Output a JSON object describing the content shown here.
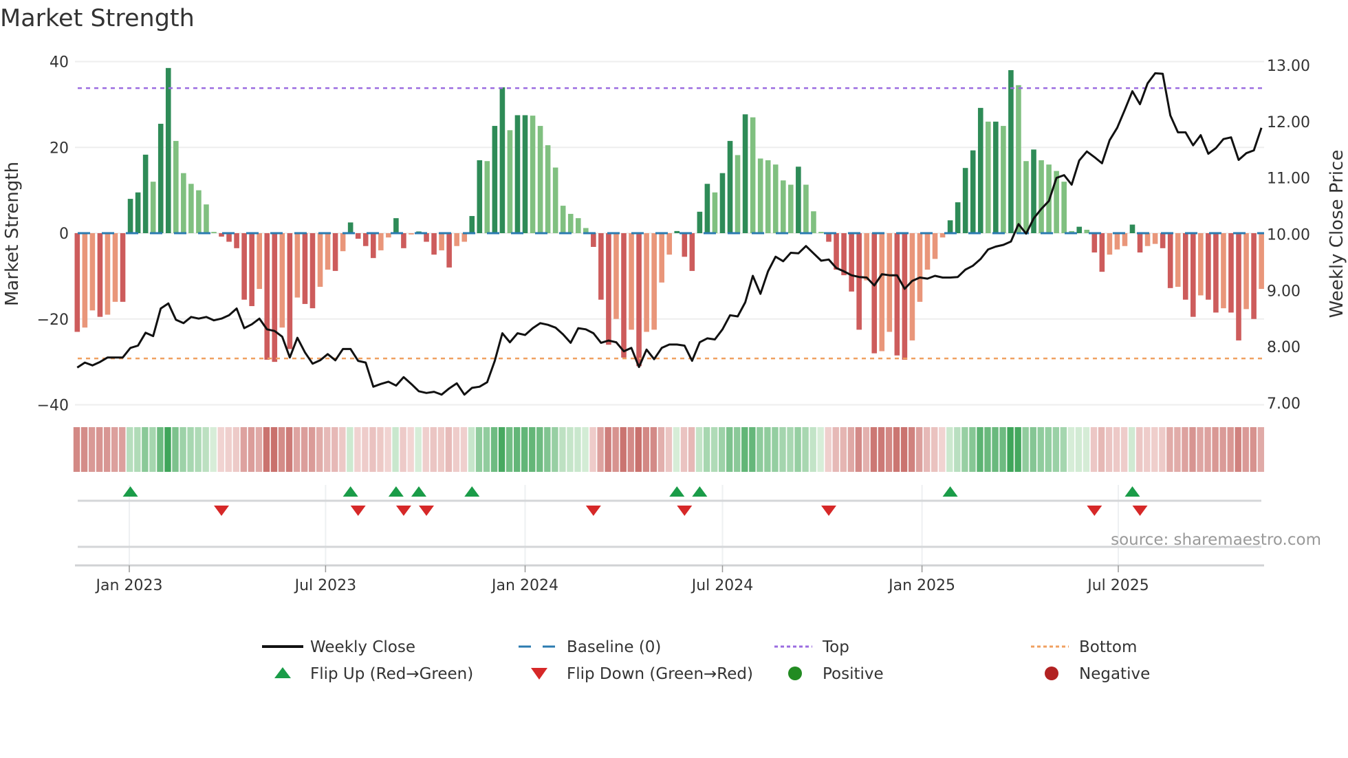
{
  "title": "Market Strength",
  "source": "source: sharemaestro.com",
  "colors": {
    "close": "#111111",
    "baseline": "#2b7bb0",
    "top": "#9b6ce0",
    "bottom": "#f0a060",
    "pos_strong": "#2e8b57",
    "pos_weak": "#80c080",
    "neg_strong": "#cd5c5c",
    "neg_weak": "#e9967a",
    "flip_up": "#1a9c48",
    "flip_down": "#d62828",
    "positive": "#228b22",
    "negative": "#b22222"
  },
  "chart_data": {
    "type": "bar+line",
    "title": "Market Strength",
    "ylabel": "Market Strength",
    "y2label": "Weekly Close Price",
    "ylim": [
      -40,
      40
    ],
    "y2lim": [
      7.0,
      13.0
    ],
    "yticks": [
      "40",
      "20",
      "0",
      "−20",
      "−40"
    ],
    "yticks_values": [
      40,
      20,
      0,
      -20,
      -40
    ],
    "y2ticks": [
      "13.00",
      "12.00",
      "11.00",
      "10.00",
      "9.00",
      "8.00",
      "7.00"
    ],
    "y2ticks_values": [
      13,
      12,
      11,
      10,
      9,
      8,
      7
    ],
    "xticks": [
      {
        "label": "Jan 2023",
        "date": "2023-01-01"
      },
      {
        "label": "Jul 2023",
        "date": "2023-07-01"
      },
      {
        "label": "Jan 2024",
        "date": "2024-01-01"
      },
      {
        "label": "Jul 2024",
        "date": "2024-07-01"
      },
      {
        "label": "Jan 2025",
        "date": "2025-01-01"
      },
      {
        "label": "Jul 2025",
        "date": "2025-07-01"
      }
    ],
    "start_week": "2022-11-14",
    "top_level": 33.8,
    "bottom_level": -29.2,
    "baseline": 0,
    "strength": [
      -23,
      -22,
      -18,
      -19.5,
      -19,
      -16,
      -16,
      8,
      9.5,
      18.3,
      12,
      25.5,
      38.5,
      21.5,
      14,
      11.5,
      10,
      6.7,
      0.3,
      -0.8,
      -2,
      -3.5,
      -15.5,
      -17,
      -13,
      -29.5,
      -30,
      -22,
      -27,
      -15,
      -16.5,
      -17.5,
      -12.5,
      -8.5,
      -8.8,
      -4.2,
      2.5,
      -1.3,
      -3,
      -5.8,
      -4,
      -1,
      3.5,
      -3.5,
      -0.3,
      0.4,
      -2,
      -5,
      -4,
      -8,
      -3,
      -2,
      4,
      17,
      16.8,
      25,
      34,
      24,
      27.5,
      27.5,
      27.4,
      25,
      20.5,
      15.3,
      6.4,
      4.5,
      3.5,
      1.2,
      -3.2,
      -15.5,
      -26,
      -20,
      -29,
      -22.5,
      -31,
      -23,
      -22.5,
      -11.5,
      -5,
      0.5,
      -5.5,
      -8.8,
      5,
      11.5,
      9.5,
      14,
      21.5,
      18.2,
      27.7,
      27,
      17.4,
      17,
      16,
      12.3,
      11.3,
      15.5,
      11.3,
      5.1,
      0.3,
      -2,
      -8.5,
      -9.8,
      -13.6,
      -22.5,
      -11,
      -28,
      -27.5,
      -23,
      -28.5,
      -29.5,
      -25,
      -16,
      -8.5,
      -6,
      -1,
      3,
      7.2,
      15.2,
      19.3,
      29.2,
      26,
      26,
      25,
      38,
      34.5,
      16.8,
      19.5,
      17,
      16,
      14.5,
      12,
      0.5,
      1.5,
      0.8,
      -4.5,
      -9,
      -5,
      -3.8,
      -3,
      2,
      -4.5,
      -3,
      -2.5,
      -3.5,
      -12.8,
      -12.5,
      -15.5,
      -19.5,
      -14.5,
      -15.5,
      -18.5,
      -17.5,
      -18.5,
      -25,
      -17.7,
      -20,
      -13
    ],
    "weekly_close": [
      7.63,
      7.72,
      7.67,
      7.73,
      7.81,
      7.81,
      7.81,
      7.98,
      8.02,
      8.25,
      8.19,
      8.68,
      8.77,
      8.48,
      8.42,
      8.53,
      8.5,
      8.53,
      8.47,
      8.5,
      8.56,
      8.68,
      8.33,
      8.4,
      8.5,
      8.31,
      8.28,
      8.18,
      7.81,
      8.16,
      7.9,
      7.7,
      7.76,
      7.87,
      7.76,
      7.96,
      7.96,
      7.75,
      7.72,
      7.29,
      7.34,
      7.38,
      7.31,
      7.46,
      7.34,
      7.21,
      7.18,
      7.2,
      7.15,
      7.26,
      7.35,
      7.15,
      7.27,
      7.29,
      7.37,
      7.75,
      8.24,
      8.08,
      8.24,
      8.21,
      8.33,
      8.42,
      8.39,
      8.34,
      8.22,
      8.07,
      8.33,
      8.31,
      8.24,
      8.07,
      8.11,
      8.08,
      7.92,
      7.98,
      7.64,
      7.95,
      7.78,
      7.98,
      8.04,
      8.04,
      8.02,
      7.75,
      8.08,
      8.15,
      8.13,
      8.31,
      8.56,
      8.54,
      8.79,
      9.26,
      8.94,
      9.34,
      9.6,
      9.52,
      9.67,
      9.66,
      9.79,
      9.66,
      9.53,
      9.55,
      9.4,
      9.34,
      9.27,
      9.24,
      9.23,
      9.09,
      9.29,
      9.27,
      9.27,
      9.03,
      9.17,
      9.23,
      9.21,
      9.26,
      9.23,
      9.23,
      9.24,
      9.37,
      9.44,
      9.56,
      9.73,
      9.78,
      9.81,
      9.87,
      10.18,
      10.01,
      10.28,
      10.45,
      10.59,
      11.0,
      11.05,
      10.88,
      11.31,
      11.47,
      11.37,
      11.26,
      11.67,
      11.89,
      12.21,
      12.54,
      12.31,
      12.68,
      12.86,
      12.85,
      12.11,
      11.81,
      11.81,
      11.58,
      11.76,
      11.43,
      11.53,
      11.69,
      11.72,
      11.32,
      11.44,
      11.49,
      11.89
    ],
    "flip_up_dates": [
      "2023-01-02",
      "2023-07-24",
      "2023-09-04",
      "2023-09-25",
      "2023-11-13",
      "2024-05-20",
      "2024-06-10",
      "2025-01-27",
      "2025-07-14"
    ],
    "flip_down_dates": [
      "2023-03-27",
      "2023-07-31",
      "2023-09-11",
      "2023-10-02",
      "2024-03-04",
      "2024-05-27",
      "2024-10-07",
      "2025-06-09",
      "2025-07-21"
    ],
    "legend_position": "bottom",
    "grid": true
  },
  "legend": [
    {
      "label": "Weekly Close",
      "kind": "line"
    },
    {
      "label": "Baseline (0)",
      "kind": "dash"
    },
    {
      "label": "Top",
      "kind": "dot-top"
    },
    {
      "label": "Bottom",
      "kind": "dot-bottom"
    },
    {
      "label": "Flip Up (Red→Green)",
      "kind": "tri-up"
    },
    {
      "label": "Flip Down (Green→Red)",
      "kind": "tri-down"
    },
    {
      "label": "Positive",
      "kind": "dot-pos"
    },
    {
      "label": "Negative",
      "kind": "dot-neg"
    }
  ]
}
